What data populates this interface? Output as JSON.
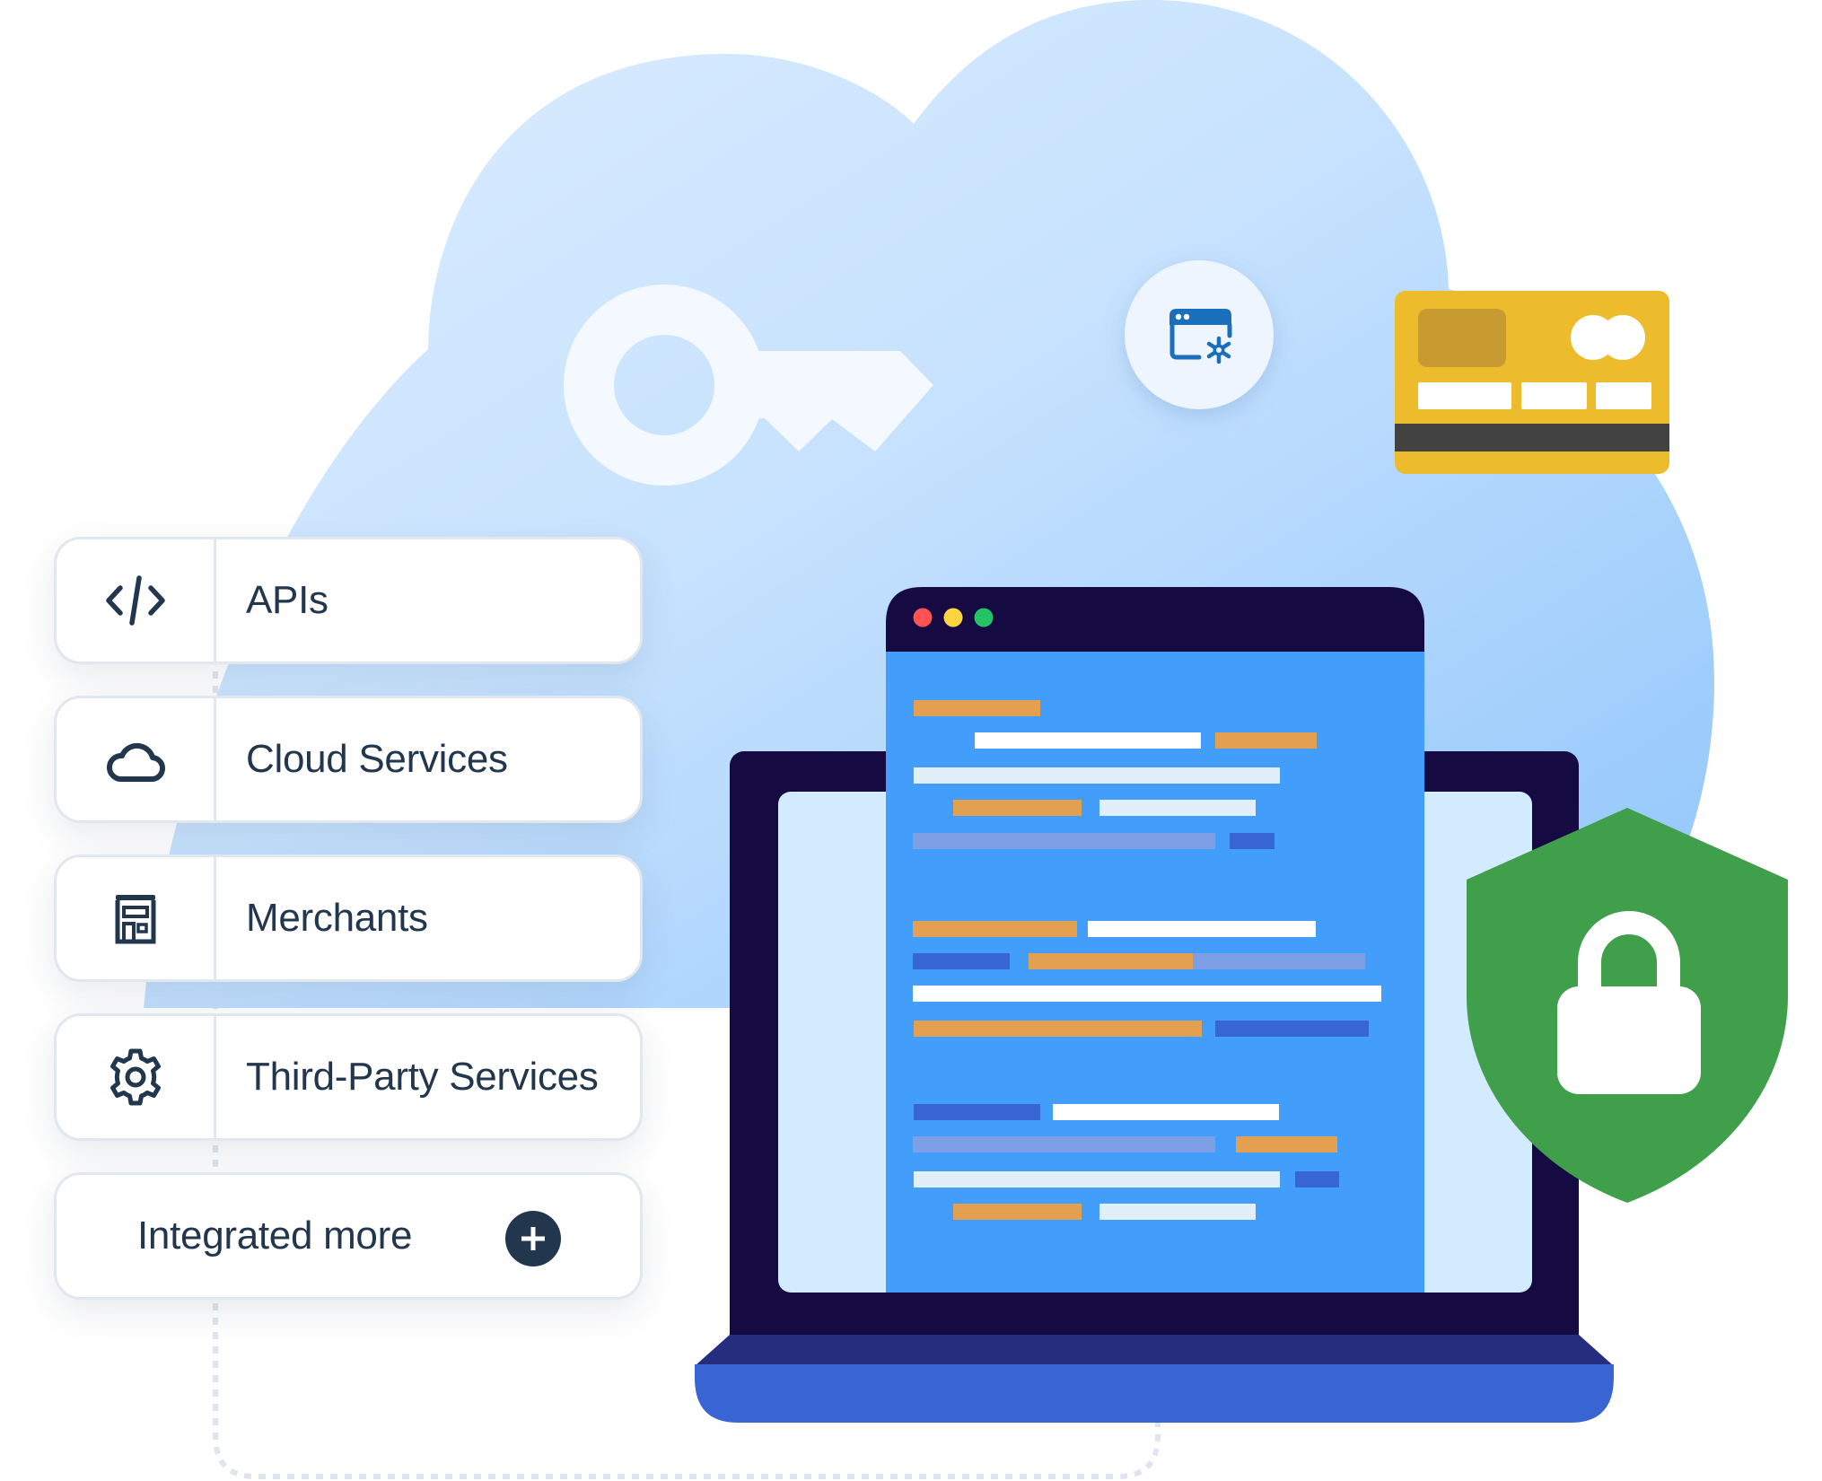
{
  "integrations": {
    "items": [
      {
        "label": "APIs",
        "icon": "code-icon"
      },
      {
        "label": "Cloud Services",
        "icon": "cloud-icon"
      },
      {
        "label": "Merchants",
        "icon": "storefront-icon"
      },
      {
        "label": "Third-Party Services",
        "icon": "gear-icon"
      }
    ],
    "more": {
      "label": "Integrated more",
      "icon": "plus-circle-icon"
    }
  },
  "illustration": {
    "cloud": {
      "icon": "cloud-background"
    },
    "key": {
      "icon": "key-icon"
    },
    "browser_settings": {
      "icon": "browser-gear-icon"
    },
    "credit_card": {
      "icon": "credit-card-icon"
    },
    "laptop": {
      "icon": "laptop-icon",
      "window_dots": [
        "red",
        "yellow",
        "green"
      ]
    },
    "shield": {
      "icon": "shield-lock-icon"
    }
  },
  "colors": {
    "text": "#22374d",
    "cloud_light": "#d6e9fd",
    "cloud_dark": "#93c8fc",
    "laptop_frame": "#150a41",
    "code_bg": "#429dfb",
    "screen_bg": "#d2ebfe",
    "code_orange": "#e4a051",
    "code_dark_blue": "#3865d4",
    "code_muted": "#7c9fe6",
    "code_light": "#e3eefb",
    "card_yellow": "#ecbc2c",
    "card_chip": "#c89b30",
    "card_stripe": "#424242",
    "shield_green": "#409f4a",
    "laptop_base": "#3864d4",
    "laptop_hinge": "#252d7e",
    "dot_red": "#fe5353",
    "dot_yellow": "#fed541",
    "dot_green": "#26c266",
    "icon_blue": "#1a6fbd"
  }
}
